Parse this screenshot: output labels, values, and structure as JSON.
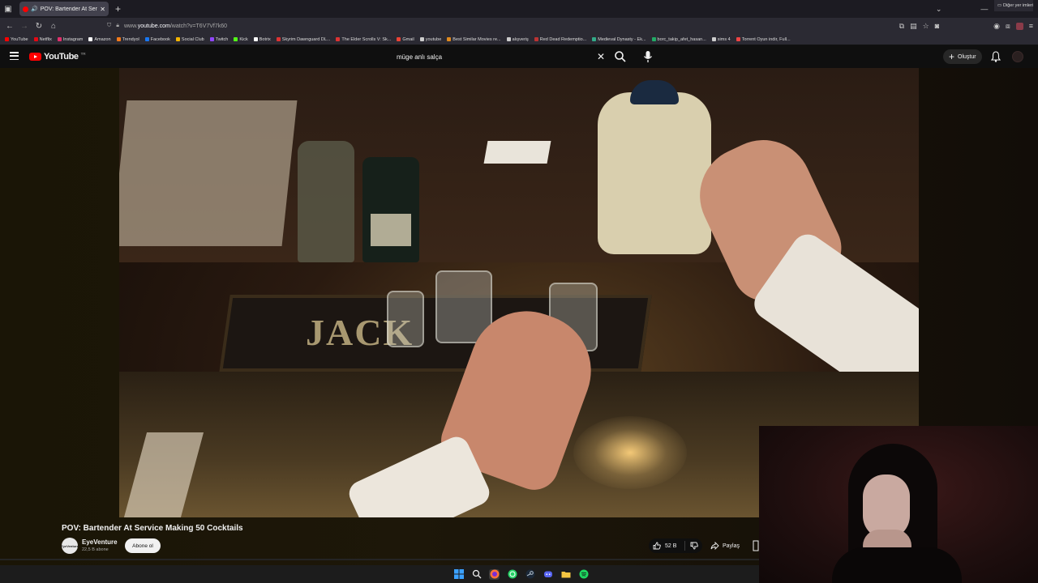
{
  "browser": {
    "tab_title": "POV: Bartender At Service |",
    "url_host": "www.",
    "url_domain": "youtube.com",
    "url_path": "/watch?v=T6V7Vf7k60",
    "bookmarks": [
      {
        "label": "YouTube",
        "color": "#ff0000"
      },
      {
        "label": "Netflix",
        "color": "#e50914"
      },
      {
        "label": "Instagram",
        "color": "#e1306c"
      },
      {
        "label": "Amazon",
        "color": "#ffffff"
      },
      {
        "label": "Trendyol",
        "color": "#f27a1a"
      },
      {
        "label": "Facebook",
        "color": "#1877f2"
      },
      {
        "label": "Social Club",
        "color": "#f4b400"
      },
      {
        "label": "Twitch",
        "color": "#9146ff"
      },
      {
        "label": "Kick",
        "color": "#53fc18"
      },
      {
        "label": "Botrix",
        "color": "#ffffff"
      },
      {
        "label": "Skyrim Dawnguard DL...",
        "color": "#d33"
      },
      {
        "label": "The Elder Scrolls V: Sk...",
        "color": "#d33"
      },
      {
        "label": "Gmail",
        "color": "#ea4335"
      },
      {
        "label": "youtube",
        "color": "#cccccc"
      },
      {
        "label": "Best Similar Movies re...",
        "color": "#e08a1e"
      },
      {
        "label": "alışveriş",
        "color": "#cccccc"
      },
      {
        "label": "Red Dead Redemptio...",
        "color": "#b33"
      },
      {
        "label": "Medieval Dynasty - Ek...",
        "color": "#3a8"
      },
      {
        "label": "borc_takip_afet_hasan...",
        "color": "#2a6"
      },
      {
        "label": "sims 4",
        "color": "#cccccc"
      },
      {
        "label": "Torrent Oyun indir, Full...",
        "color": "#e44"
      }
    ],
    "other_bookmarks": "Diğer yer imleri"
  },
  "youtube": {
    "logo_text": "YouTube",
    "logo_region": "TR",
    "search_value": "müge anlı salça",
    "create_label": "Oluştur"
  },
  "video": {
    "title": "POV: Bartender At Service Making 50 Cocktails",
    "channel_name": "EyeVenture",
    "channel_avatar_text": "EyeVenture",
    "subscribers": "22,5 B abone",
    "subscribe_label": "Abone ol",
    "likes": "52 B",
    "share_label": "Paylaş",
    "mat_text": "JACK"
  },
  "colors": {
    "yt_red": "#ff0000",
    "bg": "#0f0f0f"
  }
}
